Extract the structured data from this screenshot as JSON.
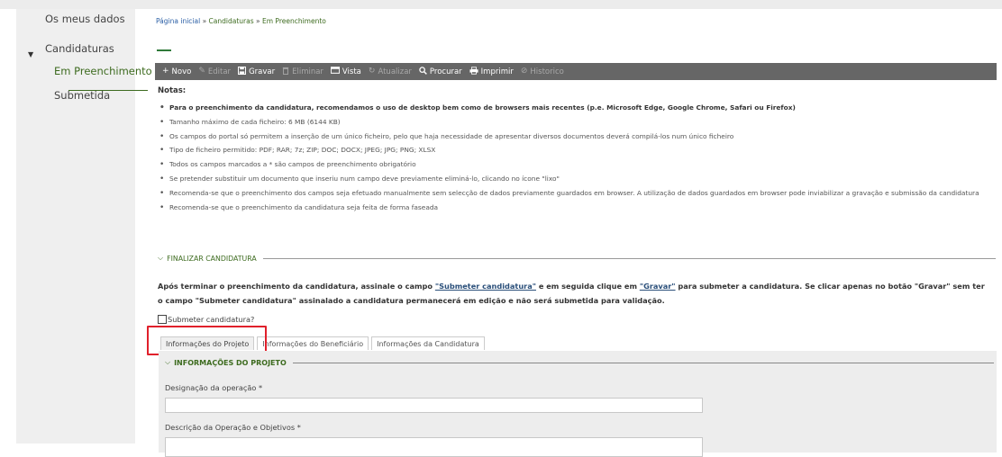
{
  "sidebar": {
    "items": [
      {
        "label": "Os meus dados"
      },
      {
        "label": "Candidaturas"
      },
      {
        "label": "Em Preenchimento"
      },
      {
        "label": "Submetida"
      }
    ]
  },
  "breadcrumb": {
    "home": "Página inicial",
    "separator": "»",
    "section": "Candidaturas",
    "current": "Em Preenchimento"
  },
  "toolbar": {
    "items": [
      {
        "label": "Novo",
        "icon": "plus-icon",
        "enabled": true
      },
      {
        "label": "Editar",
        "icon": "pencil-icon",
        "enabled": false
      },
      {
        "label": "Gravar",
        "icon": "save-icon",
        "enabled": true
      },
      {
        "label": "Eliminar",
        "icon": "trash-icon",
        "enabled": false
      },
      {
        "label": "Vista",
        "icon": "view-icon",
        "enabled": true
      },
      {
        "label": "Atualizar",
        "icon": "refresh-icon",
        "enabled": false
      },
      {
        "label": "Procurar",
        "icon": "search-icon",
        "enabled": true
      },
      {
        "label": "Imprimir",
        "icon": "print-icon",
        "enabled": true
      },
      {
        "label": "Historico",
        "icon": "history-icon",
        "enabled": false
      }
    ]
  },
  "notes": {
    "label": "Notas:",
    "items": [
      "Para o preenchimento da candidatura, recomendamos o uso de desktop bem como de browsers mais recentes (p.e. Microsoft Edge, Google Chrome, Safari ou Firefox)",
      "Tamanho máximo de cada ficheiro: 6 MB (6144 KB)",
      "Os campos do portal só permitem a inserção de um único ficheiro, pelo que haja necessidade de apresentar diversos documentos deverá compilá-los num único ficheiro",
      "Tipo de ficheiro permitido: PDF; RAR; 7z; ZIP; DOC; DOCX; JPEG; JPG; PNG; XLSX",
      "Todos os campos marcados a * são campos de preenchimento obrigatório",
      "Se pretender substituir um documento que inseriu num campo deve previamente eliminá-lo, clicando no ícone \"lixo\"",
      "Recomenda-se que o preenchimento dos campos seja efetuado manualmente sem selecção de dados previamente guardados em browser. A utilização de dados guardados em browser pode inviabilizar a gravação e submissão da candidatura",
      "Recomenda-se que o preenchimento da candidatura seja feita de forma faseada"
    ]
  },
  "finalizar": {
    "title": "FINALIZAR CANDIDATURA",
    "text_part1": "Após terminar o preenchimento da candidatura, assinale o campo ",
    "link1": "\"Submeter candidatura\"",
    "text_part2": " e em seguida clique em ",
    "link2": "\"Gravar\"",
    "text_part3": " para submeter a candidatura. Se clicar apenas no botão \"Gravar\" sem ter o campo \"Submeter candidatura\" assinalado a candidatura permanecerá em edição e não será submetida para validação.",
    "checkbox_label": "Submeter candidatura?",
    "checkbox_checked": false
  },
  "tabs": [
    {
      "label": "Informações do Projeto",
      "active": true
    },
    {
      "label": "Informações do Beneficiário",
      "active": false
    },
    {
      "label": "Informações da Candidatura",
      "active": false
    }
  ],
  "panel": {
    "title": "INFORMAÇÕES DO PROJETO",
    "fields": [
      {
        "label": "Designação da operação *",
        "value": ""
      },
      {
        "label": "Descrição da Operação e Objetivos *",
        "value": ""
      }
    ]
  },
  "colors": {
    "toolbar_bg": "#666666",
    "accent_green": "#3d6b1f",
    "highlight_red": "#e0202b",
    "sidebar_bg": "#efefef",
    "panel_bg": "#ededed"
  }
}
